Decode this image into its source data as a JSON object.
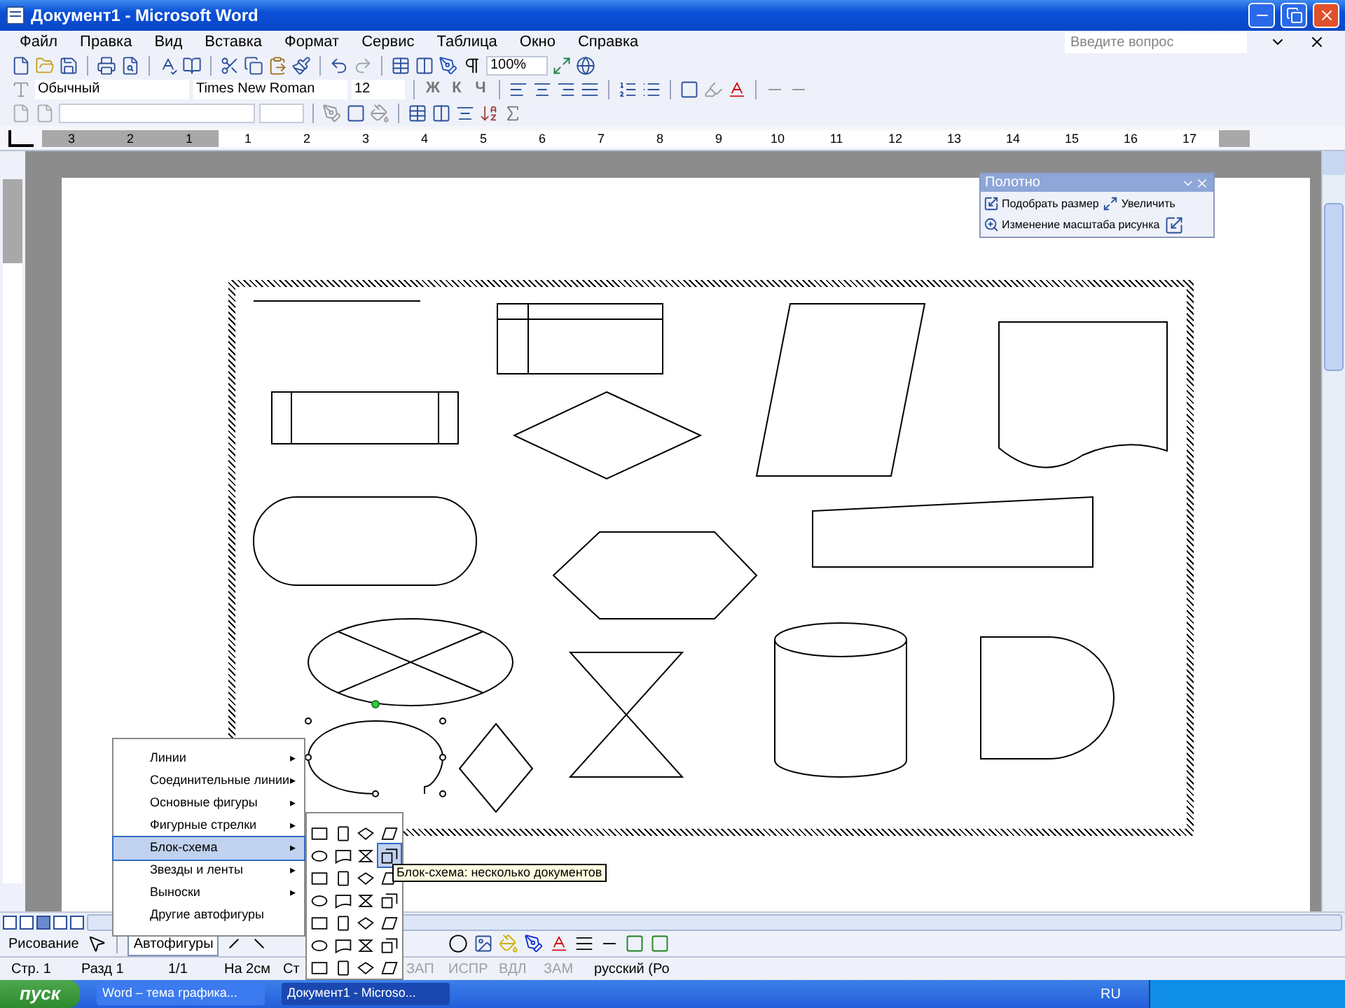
{
  "window": {
    "title": "Документ1 - Microsoft Word"
  },
  "menu": [
    "Файл",
    "Правка",
    "Вид",
    "Вставка",
    "Формат",
    "Сервис",
    "Таблица",
    "Окно",
    "Справка"
  ],
  "help_search": {
    "placeholder": "Введите вопрос"
  },
  "standard_toolbar": {
    "zoom": "100%"
  },
  "formatting_toolbar": {
    "style": "Обычный",
    "font": "Times New Roman",
    "size": "12",
    "format_buttons": [
      "Ж",
      "К",
      "Ч"
    ]
  },
  "ruler": {
    "numbers": [
      "3",
      "2",
      "1",
      "1",
      "2",
      "3",
      "4",
      "5",
      "6",
      "7",
      "8",
      "9",
      "10",
      "11",
      "12",
      "13",
      "14",
      "15",
      "16",
      "17"
    ]
  },
  "canvas_toolbar": {
    "title": "Полотно",
    "buttons": [
      "Подобрать размер",
      "Увеличить",
      "Изменение масштаба рисунка"
    ]
  },
  "autoshapes_menu": [
    {
      "label": "Линии",
      "selected": false,
      "arrow": "▸"
    },
    {
      "label": "Соединительные линии",
      "selected": false,
      "arrow": "▸"
    },
    {
      "label": "Основные фигуры",
      "selected": false,
      "arrow": "▸"
    },
    {
      "label": "Фигурные стрелки",
      "selected": false,
      "arrow": "▸"
    },
    {
      "label": "Блок-схема",
      "selected": true,
      "arrow": "▸"
    },
    {
      "label": "Звезды и ленты",
      "selected": false,
      "arrow": "▸"
    },
    {
      "label": "Выноски",
      "selected": false,
      "arrow": "▸"
    },
    {
      "label": "Другие автофигуры",
      "selected": false
    }
  ],
  "flowchart_palette": [
    {
      "selected": false
    },
    {
      "selected": false
    },
    {
      "selected": false
    },
    {
      "selected": false
    },
    {
      "selected": false
    },
    {
      "selected": false
    },
    {
      "selected": false
    },
    {
      "selected": true
    },
    {
      "selected": false
    },
    {
      "selected": false
    },
    {
      "selected": false
    },
    {
      "selected": false
    },
    {
      "selected": false
    },
    {
      "selected": false
    },
    {
      "selected": false
    },
    {
      "selected": false
    },
    {
      "selected": false
    },
    {
      "selected": false
    },
    {
      "selected": false
    },
    {
      "selected": false
    },
    {
      "selected": false
    },
    {
      "selected": false
    },
    {
      "selected": false
    },
    {
      "selected": false
    },
    {
      "selected": false
    },
    {
      "selected": false
    },
    {
      "selected": false
    },
    {
      "selected": false
    }
  ],
  "tooltip": "Блок-схема: несколько документов",
  "drawing_toolbar": {
    "draw": "Рисование",
    "autoshapes": "Автофигуры"
  },
  "status_bar": [
    {
      "text": "Стр. 1",
      "disabled": false
    },
    {
      "text": "Разд 1",
      "disabled": false
    },
    {
      "text": "1/1",
      "disabled": false
    },
    {
      "text": "На 2см",
      "disabled": false
    },
    {
      "text": "Ст",
      "disabled": false
    },
    {
      "text": "ЗАП",
      "disabled": true
    },
    {
      "text": "ИСПР",
      "disabled": true
    },
    {
      "text": "ВДЛ",
      "disabled": true
    },
    {
      "text": "ЗАМ",
      "disabled": true
    },
    {
      "text": "русский (Ро",
      "disabled": false
    }
  ],
  "taskbar": {
    "start": "пуск",
    "tasks": [
      {
        "label": "Word – тема графика...",
        "selected": false
      },
      {
        "label": "Документ1 - Microso...",
        "selected": true
      }
    ],
    "language": "RU"
  }
}
